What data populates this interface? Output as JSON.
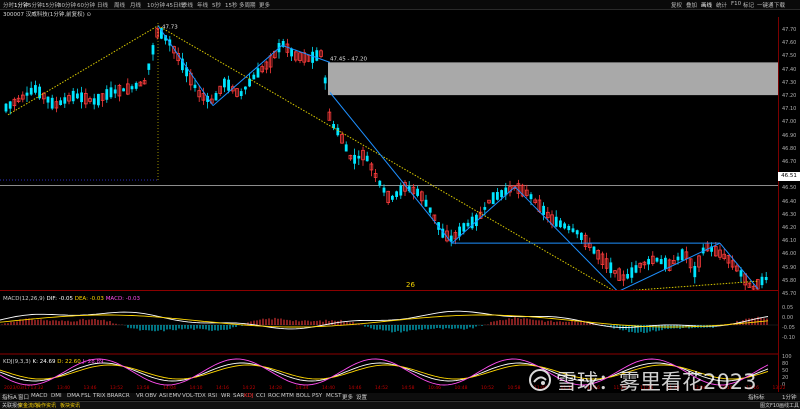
{
  "toolbar": {
    "periods": [
      "分时",
      "1分钟",
      "5分钟",
      "15分钟",
      "30分钟",
      "60分钟",
      "日线",
      "周线",
      "月线",
      "10分钟",
      "45日线",
      "季线",
      "年线",
      "5秒",
      "15秒",
      "多周期",
      "更多"
    ],
    "active_period": "1分钟",
    "right_items": [
      "复权",
      "叠加",
      "画线",
      "统计",
      "F10",
      "标记",
      "一键通",
      "下载"
    ],
    "active_right": "画线"
  },
  "stock_title": "300007 汉威科技(1分钟,前复权) ⊙",
  "price_axis_labels": [
    "47.70",
    "47.60",
    "47.50",
    "47.40",
    "47.30",
    "47.20",
    "47.10",
    "47.00",
    "46.90",
    "46.80",
    "46.70",
    "46.60",
    "46.50",
    "46.40",
    "46.30",
    "46.20",
    "46.10",
    "46.00",
    "45.90",
    "45.80",
    "45.70"
  ],
  "current_price_tag": "46.51",
  "annotations": {
    "high": "47.73",
    "range": "47.45 - 47.20",
    "low": "45.70",
    "count": "26"
  },
  "macd": {
    "name": "MACD(12,26,9)",
    "dif": "DIF: -0.05",
    "dea": "DEA: -0.03",
    "macd": "MACD: -0.03",
    "axis": [
      "0.05",
      "0.00",
      "-0.05",
      "-0.10"
    ]
  },
  "kdj": {
    "name": "KDJ(9,3,3)",
    "k": "K: 24.69",
    "d": "D: 22.60",
    "j": "J: 28.89",
    "axis": [
      "100",
      "80",
      "50",
      "20",
      "0"
    ]
  },
  "time_labels": [
    "2023/03/17",
    "13:32",
    "13:40",
    "13:46",
    "13:52",
    "13:58",
    "14:04",
    "14:10",
    "14:16",
    "14:22",
    "14:28",
    "14:34",
    "14:40",
    "14:46",
    "14:52",
    "14:58",
    "10:46",
    "10:48",
    "10:52",
    "10:58",
    "11:04",
    "11:10",
    "11:16",
    "11:20",
    "11:26",
    "11:30",
    "13:04",
    "13:10",
    "13:16",
    "13:22"
  ],
  "indicators": [
    "指标A",
    "窗口",
    "MACD",
    "DMI",
    "DMA",
    "FSL",
    "TRIX",
    "BRAR",
    "CR",
    "VR",
    "OBV",
    "ASI",
    "EMV",
    "VOL-TDX",
    "RSI",
    "WR",
    "SAR",
    "KDJ",
    "CCI",
    "ROC",
    "MTM",
    "BOLL",
    "PSY",
    "MCST",
    "更多",
    "设置"
  ],
  "active_indicator": "KDJ",
  "bottom_tabs": [
    "关联报价",
    "资金流向",
    "操作资讯",
    "板块资讯"
  ],
  "bottom_right": [
    "图文F10",
    "画线工具"
  ],
  "axis_right_bottom": "1分钟",
  "indicator_right": "指标标",
  "watermark": "雪球：雾里看花2023",
  "colors": {
    "up": "#ff3c3c",
    "down": "#00e5ff",
    "trend_blue": "#1e90ff",
    "trend_yellow": "#d8c800",
    "box_gray": "#a9a9a9"
  }
}
